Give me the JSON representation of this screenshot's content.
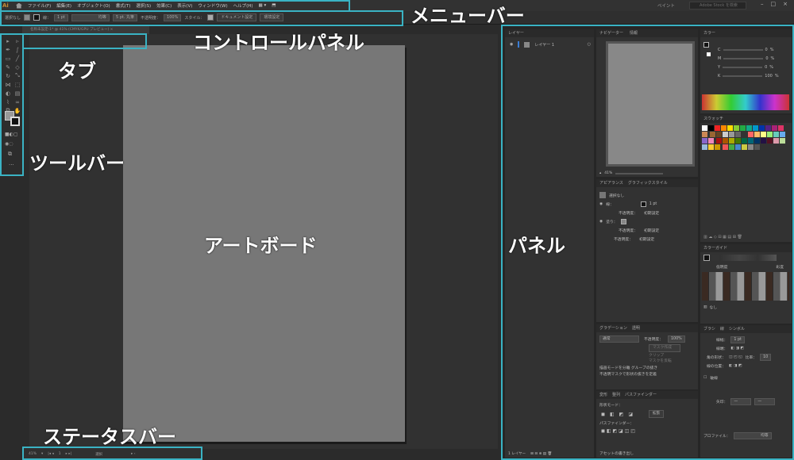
{
  "menubar": {
    "logo": "Ai",
    "items": [
      "ファイル(F)",
      "編集(E)",
      "オブジェクト(O)",
      "書式(T)",
      "選択(S)",
      "効果(C)",
      "表示(V)",
      "ウィンドウ(W)",
      "ヘルプ(H)"
    ],
    "workspace": "ベイント",
    "search_placeholder": "Adobe Stock を検索"
  },
  "control": {
    "selection": "選択なし",
    "stroke_label": "線：",
    "stroke_value": "1 pt",
    "line_style": "均等",
    "brush": "5 pt. 丸筆",
    "opacity_label": "不透明度：",
    "opacity_value": "100%",
    "style_label": "スタイル：",
    "doc_settings": "ドキュメント設定",
    "prefs": "環境設定"
  },
  "tab": {
    "label": "名称未設定-1* @ 41% (CMYK/GPU プレビュー)",
    "close": "×"
  },
  "status": {
    "zoom": "41%",
    "page": "1",
    "tool": "選択"
  },
  "panels": {
    "layers": {
      "title": "レイヤー",
      "layer_name": "レイヤー 1",
      "footer": "1 レイヤー"
    },
    "navigator": {
      "tabs": [
        "ナビゲーター",
        "情報"
      ],
      "zoom": "41%"
    },
    "appearance": {
      "tabs": [
        "アピアランス",
        "グラフィックスタイル"
      ],
      "selection": "選択なし",
      "stroke_label": "線：",
      "stroke_value": "1 pt",
      "opacity": "不透明度：",
      "default": "初期設定",
      "fill_label": "塗り："
    },
    "color": {
      "title": "カラー",
      "channels": [
        "C",
        "M",
        "Y",
        "K"
      ],
      "values": [
        "0",
        "0",
        "0",
        "100"
      ],
      "unit": "%"
    },
    "swatches": {
      "title": "スウォッチ"
    },
    "colorguide": {
      "title": "カラーガイド",
      "left": "低明度",
      "right": "彩度",
      "none": "なし"
    },
    "stroke": {
      "tabs": [
        "ブラシ",
        "線",
        "シンボル"
      ],
      "width_label": "線幅：",
      "width_value": "1 pt",
      "cap_label": "線端：",
      "corner_label": "角の形状：",
      "ratio_label": "比率：",
      "ratio_value": "10",
      "align_label": "線の位置：",
      "dashed": "破線",
      "arrow_label": "矢印：",
      "profile_label": "プロファイル：",
      "profile_value": "均等"
    },
    "transparency": {
      "tabs": [
        "グラデーション",
        "透明"
      ],
      "mode": "通常",
      "opacity_label": "不透明度：",
      "opacity_value": "100%",
      "mask_btn": "マスク作成",
      "clip": "クリップ",
      "invert": "マスクを反転",
      "isolate": "描画モードを分離",
      "knockout": "グループの抜き",
      "define": "不透明マスクで形状の抜きを定義"
    },
    "pathfinder": {
      "tabs": [
        "変形",
        "整列",
        "パスファインダー"
      ],
      "shape_mode": "形状モード：",
      "expand": "拡張",
      "pathfinders": "パスファインダー："
    },
    "assets": {
      "label": "アセットの書き出し"
    }
  },
  "annotations": {
    "menubar": "メニューバー",
    "control": "コントロールパネル",
    "tab": "タブ",
    "toolbar": "ツールバー",
    "artboard": "アートボード",
    "panels": "パネル",
    "status": "ステータスバー"
  },
  "colors": {
    "accent": "#3ab3c4",
    "artboard": "#777777",
    "bg": "#2b2b2b"
  }
}
